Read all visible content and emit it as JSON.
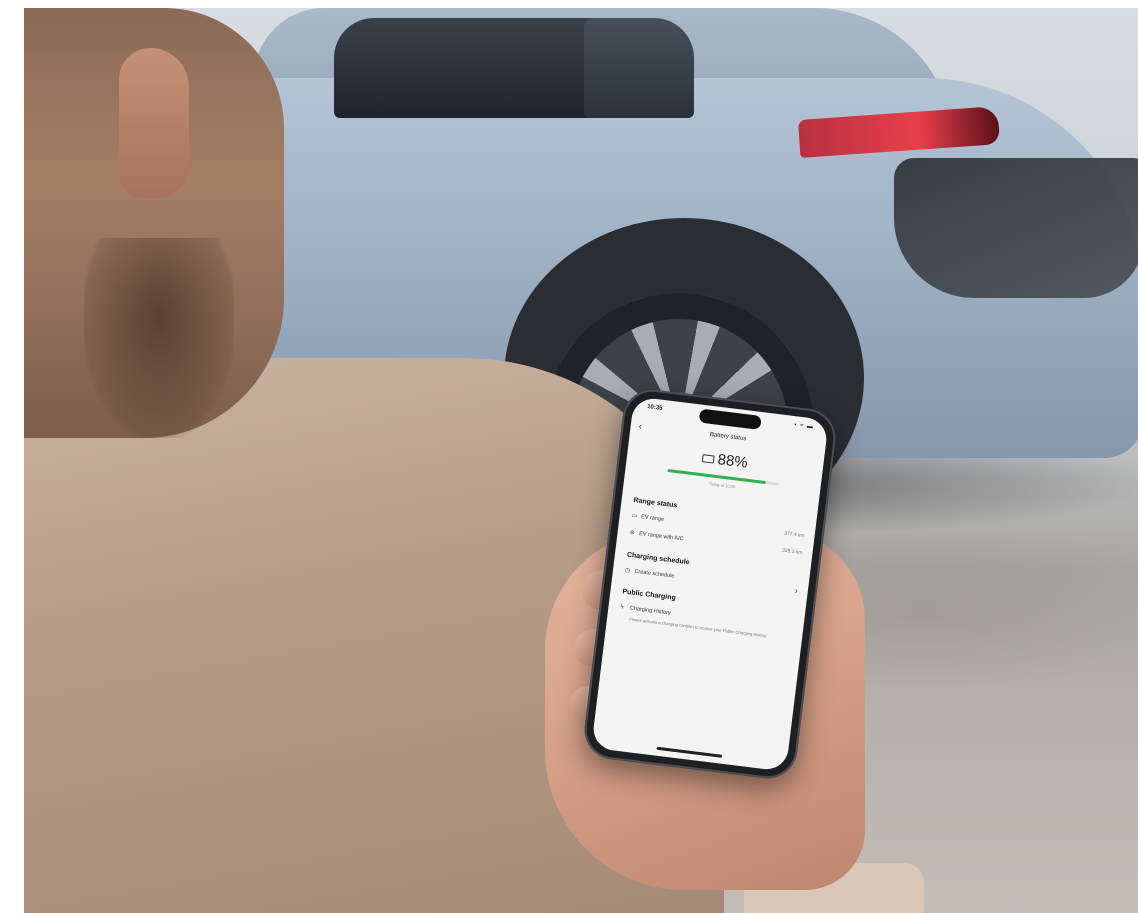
{
  "phone": {
    "status": {
      "time": "10:35",
      "icons": "▪ ≈ ▬"
    },
    "nav": {
      "back_icon": "chevron-left-icon",
      "title": "Battery status"
    },
    "battery": {
      "percent": "88%",
      "level": 0.88,
      "updated": "Today at 10:35",
      "bar_color": "#2fb24a"
    },
    "range": {
      "heading": "Range status",
      "ev_range_label": "EV range",
      "ev_range_value": "377.4 km",
      "ev_ac_label": "EV range with A/C",
      "ev_ac_value": "328.3 km"
    },
    "schedule": {
      "heading": "Charging schedule",
      "create_label": "Create schedule"
    },
    "public": {
      "heading": "Public Charging",
      "history_label": "Charging History",
      "history_info": "Please activate a charging contract to access your Public Charging History"
    }
  }
}
